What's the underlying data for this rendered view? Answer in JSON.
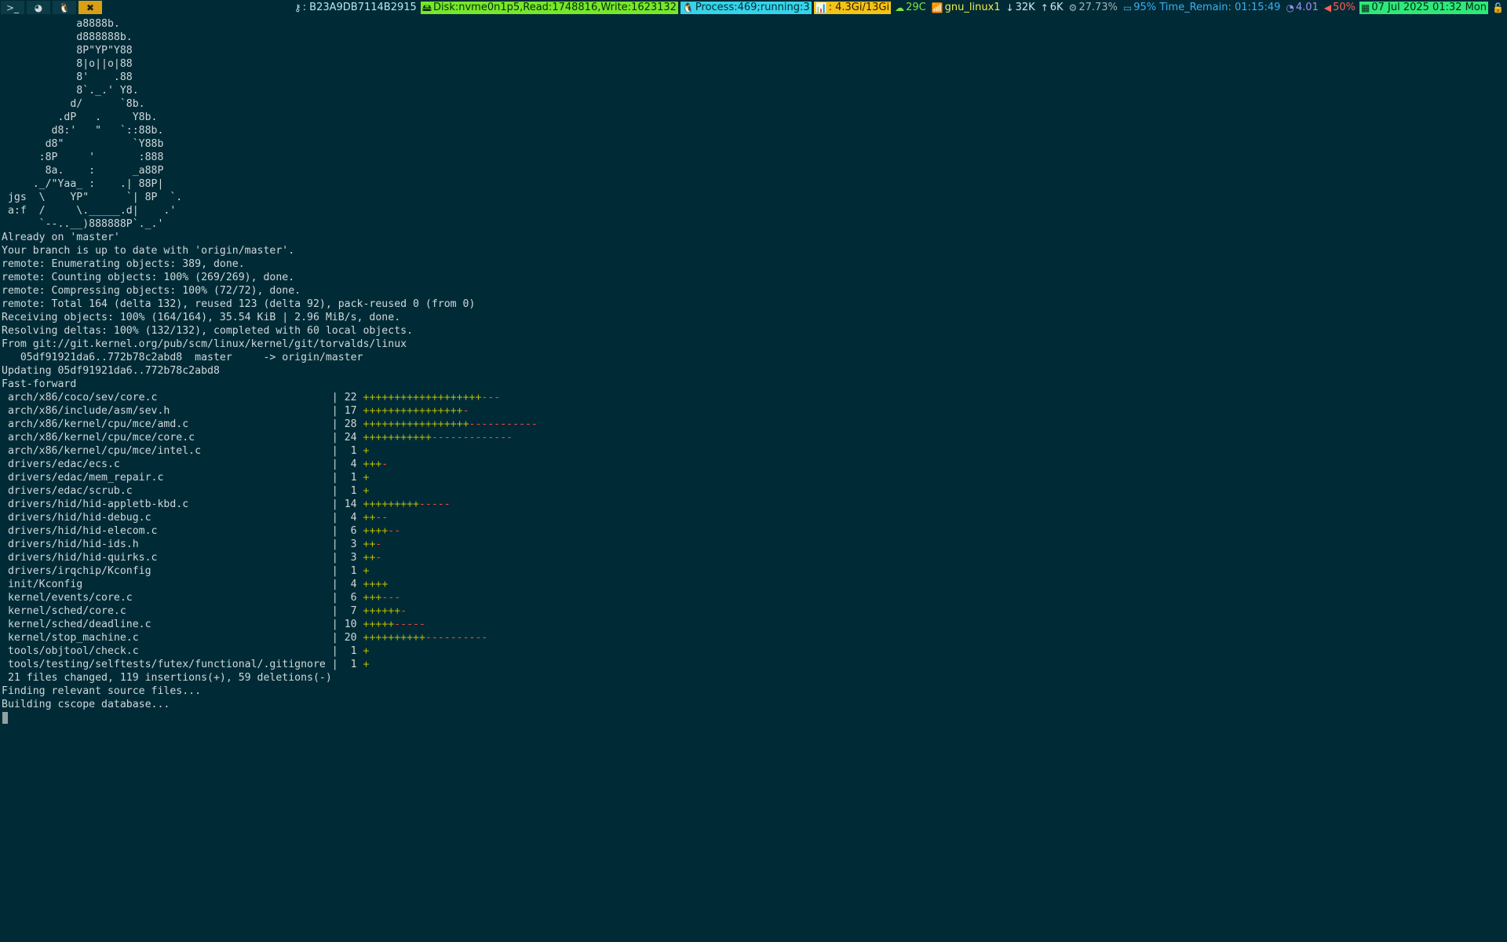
{
  "topbar": {
    "workspaces": [
      {
        "glyph": ">_",
        "icon": "terminal-icon",
        "active": false
      },
      {
        "glyph": "◕",
        "icon": "firefox-icon",
        "active": false
      },
      {
        "glyph": "🐧",
        "icon": "linux-icon",
        "active": false
      },
      {
        "glyph": "✖",
        "icon": "tools-icon",
        "active": true
      }
    ],
    "modules": {
      "wm": {
        "icon": "key-icon",
        "glyph": "⚷",
        "text": ": B23A9DB7114B2915"
      },
      "disk": {
        "icon": "disk-icon",
        "glyph": "🖴",
        "text": "Disk:nvme0n1p5,Read:1748816,Write:1623132"
      },
      "process": {
        "icon": "linux-icon",
        "glyph": "🐧",
        "text": "Process:469;running:3"
      },
      "memory": {
        "icon": "bar-chart-icon",
        "glyph": "📊",
        "text": ": 4.3Gi/13Gi"
      },
      "temperature": {
        "icon": "cloud-icon",
        "glyph": "☁",
        "text": "29C"
      },
      "wifi": {
        "icon": "wifi-icon",
        "glyph": "📶",
        "text": "gnu_linux1"
      },
      "download": {
        "icon": "arrow-down-icon",
        "glyph": "↓",
        "text": "32K"
      },
      "upload": {
        "icon": "arrow-up-icon",
        "glyph": "↑",
        "text": "6K"
      },
      "cpu": {
        "icon": "gear-icon",
        "glyph": "⚙",
        "text": "27.73%"
      },
      "battery": {
        "icon": "battery-icon",
        "glyph": "▭",
        "text": "95% Time_Remain: 01:15:49"
      },
      "load": {
        "icon": "gauge-icon",
        "glyph": "◔",
        "text": "4.01"
      },
      "volume": {
        "icon": "speaker-icon",
        "glyph": "◀",
        "text": "50%"
      },
      "datetime": {
        "icon": "calendar-icon",
        "glyph": "▦",
        "text": "07 Jul 2025 01:32 Mon"
      },
      "lock": {
        "icon": "lock-icon",
        "glyph": "🔓",
        "text": ""
      }
    },
    "colors": {
      "disk_bg": "#76e82a",
      "process_bg": "#35d4ea",
      "memory_bg": "#f3c316",
      "date_bg": "#2ee87a",
      "active_workspace_bg": "#d8a012"
    }
  },
  "terminal": {
    "ascii_art": [
      "            a8888b.",
      "            d888888b.",
      "            8P\"YP\"Y88",
      "            8|o||o|88",
      "            8'    .88",
      "            8`._.' Y8.",
      "           d/      `8b.",
      "         .dP   .     Y8b.",
      "        d8:'   \"   `::88b.",
      "       d8\"           `Y88b",
      "      :8P     '       :888",
      "       8a.    :      _a88P",
      "     ._/\"Yaa_ :    .| 88P|",
      " jgs  \\    YP\"      `| 8P  `.",
      " a:f  /     \\._____.d|    .'",
      "      `--..__)888888P`._.'"
    ],
    "git_output": [
      "Already on 'master'",
      "Your branch is up to date with 'origin/master'.",
      "remote: Enumerating objects: 389, done.",
      "remote: Counting objects: 100% (269/269), done.",
      "remote: Compressing objects: 100% (72/72), done.",
      "remote: Total 164 (delta 132), reused 123 (delta 92), pack-reused 0 (from 0)",
      "Receiving objects: 100% (164/164), 35.54 KiB | 2.96 MiB/s, done.",
      "Resolving deltas: 100% (132/132), completed with 60 local objects.",
      "From git://git.kernel.org/pub/scm/linux/kernel/git/torvalds/linux",
      "   05df91921da6..772b78c2abd8  master     -> origin/master",
      "Updating 05df91921da6..772b78c2abd8",
      "Fast-forward"
    ],
    "diffstat": [
      {
        "file": " arch/x86/coco/sev/core.c",
        "count": "22",
        "plus": "+++++++++++++++++++",
        "minus": "---"
      },
      {
        "file": " arch/x86/include/asm/sev.h",
        "count": "17",
        "plus": "++++++++++++++++",
        "minus": "-"
      },
      {
        "file": " arch/x86/kernel/cpu/mce/amd.c",
        "count": "28",
        "plus": "+++++++++++++++++",
        "minus": "-----------"
      },
      {
        "file": " arch/x86/kernel/cpu/mce/core.c",
        "count": "24",
        "plus": "+++++++++++",
        "minus": "-------------"
      },
      {
        "file": " arch/x86/kernel/cpu/mce/intel.c",
        "count": "1",
        "plus": "+",
        "minus": ""
      },
      {
        "file": " drivers/edac/ecs.c",
        "count": "4",
        "plus": "+++",
        "minus": "-"
      },
      {
        "file": " drivers/edac/mem_repair.c",
        "count": "1",
        "plus": "+",
        "minus": ""
      },
      {
        "file": " drivers/edac/scrub.c",
        "count": "1",
        "plus": "+",
        "minus": ""
      },
      {
        "file": " drivers/hid/hid-appletb-kbd.c",
        "count": "14",
        "plus": "+++++++++",
        "minus": "-----"
      },
      {
        "file": " drivers/hid/hid-debug.c",
        "count": "4",
        "plus": "++",
        "minus": "--"
      },
      {
        "file": " drivers/hid/hid-elecom.c",
        "count": "6",
        "plus": "++++",
        "minus": "--"
      },
      {
        "file": " drivers/hid/hid-ids.h",
        "count": "3",
        "plus": "++",
        "minus": "-"
      },
      {
        "file": " drivers/hid/hid-quirks.c",
        "count": "3",
        "plus": "++",
        "minus": "-"
      },
      {
        "file": " drivers/irqchip/Kconfig",
        "count": "1",
        "plus": "+",
        "minus": ""
      },
      {
        "file": " init/Kconfig",
        "count": "4",
        "plus": "++++",
        "minus": ""
      },
      {
        "file": " kernel/events/core.c",
        "count": "6",
        "plus": "+++",
        "minus": "---"
      },
      {
        "file": " kernel/sched/core.c",
        "count": "7",
        "plus": "++++++",
        "minus": "-"
      },
      {
        "file": " kernel/sched/deadline.c",
        "count": "10",
        "plus": "+++++",
        "minus": "-----"
      },
      {
        "file": " kernel/stop_machine.c",
        "count": "20",
        "plus": "++++++++++",
        "minus": "----------"
      },
      {
        "file": " tools/objtool/check.c",
        "count": "1",
        "plus": "+",
        "minus": ""
      },
      {
        "file": " tools/testing/selftests/futex/functional/.gitignore",
        "count": "1",
        "plus": "+",
        "minus": ""
      }
    ],
    "tail_output": [
      " 21 files changed, 119 insertions(+), 59 deletions(-)",
      "Finding relevant source files...",
      "Building cscope database..."
    ]
  }
}
